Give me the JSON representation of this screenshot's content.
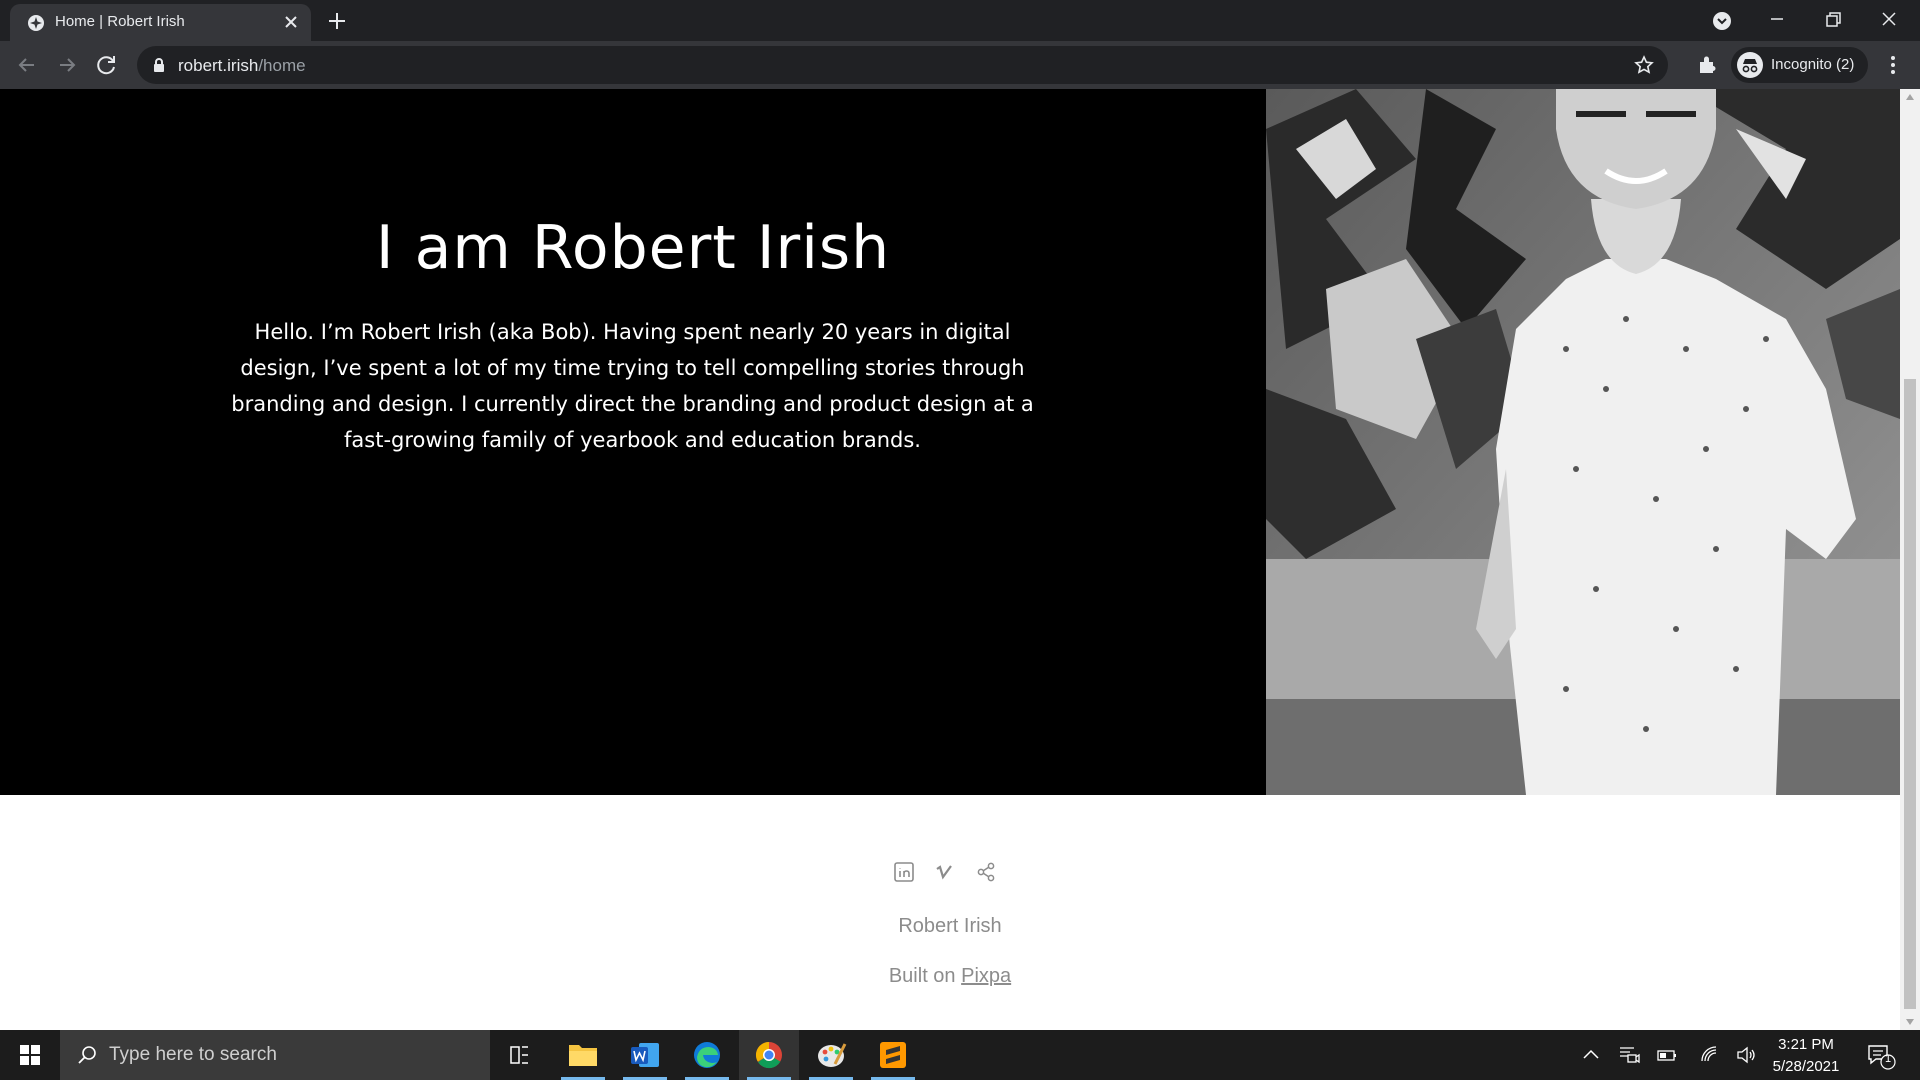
{
  "browser": {
    "tab_title": "Home | Robert Irish",
    "url_host": "robert.irish",
    "url_path": "/home",
    "incognito_label": "Incognito (2)"
  },
  "hero": {
    "title": "I am Robert Irish",
    "text": "Hello. I’m Robert Irish (aka Bob). Having spent nearly 20 years in digital design, I’ve spent a lot of my time trying to tell compelling stories through branding and design. I currently direct the branding and product design at a fast-growing family of yearbook and education brands."
  },
  "footer": {
    "name": "Robert Irish",
    "built_on": "Built on",
    "built_link": "Pixpa"
  },
  "taskbar": {
    "search_placeholder": "Type here to search",
    "time": "3:21 PM",
    "date": "5/28/2021",
    "notification_count": "1"
  }
}
